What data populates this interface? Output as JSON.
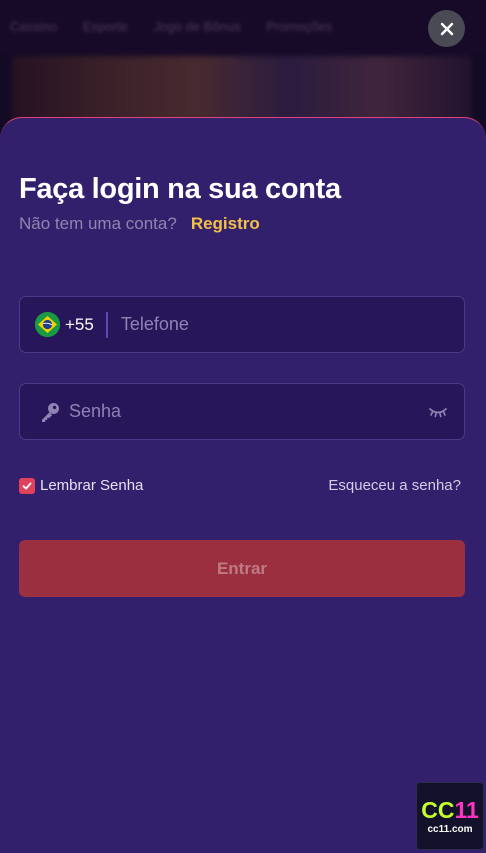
{
  "background": {
    "nav_items": [
      "Cassino",
      "Esporte",
      "Jogo de Bônus",
      "Promoções"
    ]
  },
  "login": {
    "title": "Faça login na sua conta",
    "no_account_text": "Não tem uma conta?",
    "register_link": "Registro",
    "phone": {
      "country_icon": "brazil-flag-icon",
      "dial_code": "+55",
      "placeholder": "Telefone",
      "value": ""
    },
    "password": {
      "leading_icon": "key-icon",
      "placeholder": "Senha",
      "value": "",
      "toggle_icon": "eye-closed-icon"
    },
    "remember": {
      "label": "Lembrar Senha",
      "checked": true
    },
    "forgot_link": "Esqueceu a senha?",
    "submit_label": "Entrar",
    "close_icon": "close-icon"
  },
  "brand": {
    "logo_cc": "CC",
    "logo_num": "11",
    "url": "cc11.com"
  },
  "colors": {
    "sheet_bg": "#32206c",
    "accent_yellow": "#f3c047",
    "submit_bg": "#9a2f40",
    "checkbox": "#e0425d"
  }
}
